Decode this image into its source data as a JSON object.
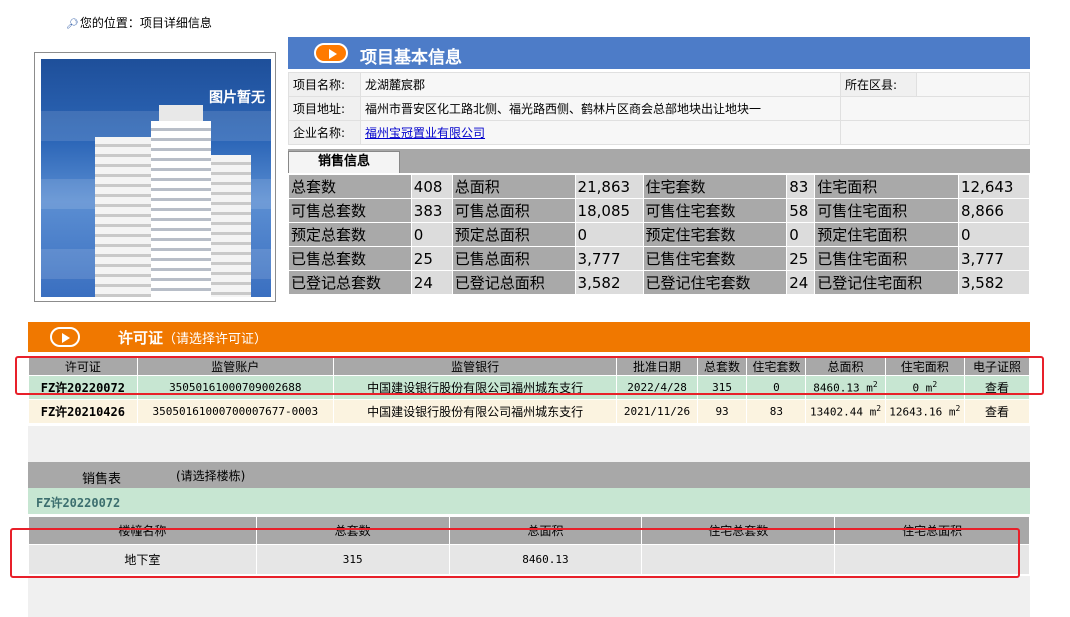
{
  "breadcrumb": {
    "icon": "search-icon",
    "text": "您的位置：项目详细信息"
  },
  "photo": {
    "placeholder_text": "图片暂无"
  },
  "project_info": {
    "title": "项目基本信息",
    "name_label": "项目名称:",
    "name_value": "龙湖麓宸郡",
    "district_label": "所在区县:",
    "district_value": "",
    "address_label": "项目地址:",
    "address_value": "福州市晋安区化工路北侧、福光路西侧、鹤林片区商会总部地块出让地块一",
    "company_label": "企业名称:",
    "company_value": "福州宝冠置业有限公司"
  },
  "sales_info": {
    "tab_label": "销售信息",
    "rows": [
      [
        [
          "总套数",
          "408"
        ],
        [
          "总面积",
          "21,863"
        ],
        [
          "住宅套数",
          "83"
        ],
        [
          "住宅面积",
          "12,643"
        ]
      ],
      [
        [
          "可售总套数",
          "383"
        ],
        [
          "可售总面积",
          "18,085"
        ],
        [
          "可售住宅套数",
          "58"
        ],
        [
          "可售住宅面积",
          "8,866"
        ]
      ],
      [
        [
          "预定总套数",
          "0"
        ],
        [
          "预定总面积",
          "0"
        ],
        [
          "预定住宅套数",
          "0"
        ],
        [
          "预定住宅面积",
          "0"
        ]
      ],
      [
        [
          "已售总套数",
          "25"
        ],
        [
          "已售总面积",
          "3,777"
        ],
        [
          "已售住宅套数",
          "25"
        ],
        [
          "已售住宅面积",
          "3,777"
        ]
      ],
      [
        [
          "已登记总套数",
          "24"
        ],
        [
          "已登记总面积",
          "3,582"
        ],
        [
          "已登记住宅套数",
          "24"
        ],
        [
          "已登记住宅面积",
          "3,582"
        ]
      ]
    ]
  },
  "permits": {
    "title": "许可证",
    "subtitle": "（请选择许可证）",
    "columns": [
      "许可证",
      "监管账户",
      "监管银行",
      "批准日期",
      "总套数",
      "住宅套数",
      "总面积",
      "住宅面积",
      "电子证照"
    ],
    "rows": [
      {
        "permit_no": "FZ许20220072",
        "account": "35050161000709002688",
        "bank": "中国建设银行股份有限公司福州城东支行",
        "date": "2022/4/28",
        "total_units": "315",
        "res_units": "0",
        "total_area": "8460.13 m",
        "res_area": "0 m",
        "area_sup": "2",
        "action": "查看"
      },
      {
        "permit_no": "FZ许20210426",
        "account": "35050161000700007677-0003",
        "bank": "中国建设银行股份有限公司福州城东支行",
        "date": "2021/11/26",
        "total_units": "93",
        "res_units": "83",
        "total_area": "13402.44 m",
        "res_area": "12643.16 m",
        "area_sup": "2",
        "action": "查看"
      }
    ]
  },
  "sales_sheet": {
    "label": "销售表",
    "hint": "(请选择楼栋)",
    "selected_permit": "FZ许20220072",
    "columns": [
      "楼幢名称",
      "总套数",
      "总面积",
      "住宅总套数",
      "住宅总面积"
    ],
    "rows": [
      {
        "building": "地下室",
        "total_units": "315",
        "total_area": "8460.13",
        "res_units": "",
        "res_area": ""
      }
    ]
  },
  "colors": {
    "blue_header": "#4d7cc8",
    "orange_header": "#f07800",
    "highlight": "#e8202a",
    "row_green": "#c7e6d2",
    "row_cream": "#fbf3e0"
  }
}
